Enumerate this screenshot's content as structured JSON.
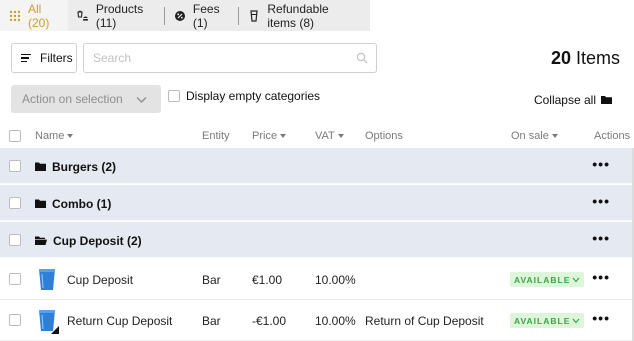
{
  "tabs": [
    {
      "label": "All (20)",
      "icon": "grid-dots-icon",
      "active": true
    },
    {
      "label": "Products (11)",
      "icon": "burger-fries-icon",
      "active": false
    },
    {
      "label": "Fees (1)",
      "icon": "fee-badge-icon",
      "active": false
    },
    {
      "label": "Refundable items (8)",
      "icon": "cup-icon",
      "active": false
    }
  ],
  "toolbar": {
    "filters_label": "Filters",
    "search_placeholder": "Search",
    "search_value": "",
    "items_count": "20",
    "items_label": "Items",
    "action_label": "Action on selection",
    "display_empty_label": "Display empty categories",
    "collapse_all_label": "Collapse all"
  },
  "columns": {
    "name": "Name",
    "entity": "Entity",
    "price": "Price",
    "vat": "VAT",
    "options": "Options",
    "on_sale": "On sale",
    "actions": "Actions"
  },
  "categories": [
    {
      "name": "Burgers (2)"
    },
    {
      "name": "Combo (1)"
    },
    {
      "name": "Cup Deposit (2)"
    }
  ],
  "products": [
    {
      "name": "Cup Deposit",
      "entity": "Bar",
      "price": "€1.00",
      "vat": "10.00%",
      "options": "",
      "status": "AVAILABLE"
    },
    {
      "name": "Return Cup Deposit",
      "entity": "Bar",
      "price": "-€1.00",
      "vat": "10.00%",
      "options": "Return of Cup Deposit",
      "status": "AVAILABLE"
    }
  ],
  "more_label": "•••",
  "colors": {
    "accent": "#c9a227",
    "category_bg": "#e5e9f1",
    "available_bg": "#ddf5d8",
    "available_text": "#3aa64a",
    "cup_blue": "#2f7fd6"
  }
}
